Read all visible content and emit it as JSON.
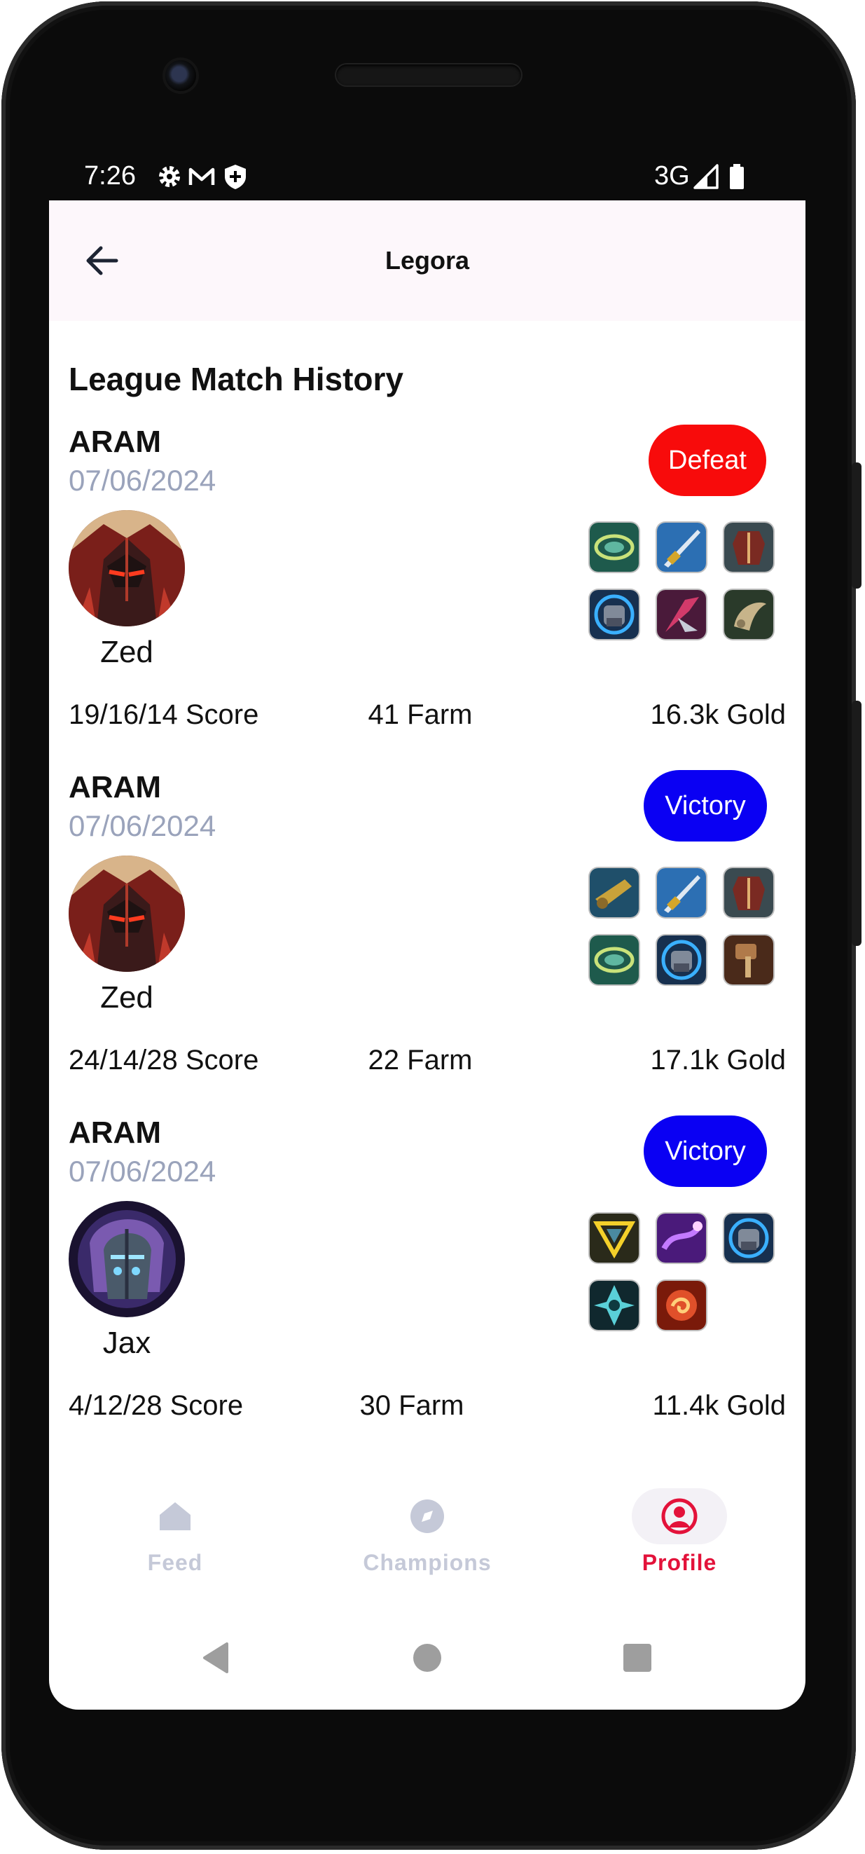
{
  "status_bar": {
    "time": "7:26",
    "network": "3G",
    "icons": [
      "settings-icon",
      "gmail-icon",
      "shield-icon",
      "signal-icon",
      "battery-icon"
    ]
  },
  "app_bar": {
    "title": "Legora",
    "back_icon": "arrow-left-icon"
  },
  "section_title": "League Match History",
  "matches": [
    {
      "mode": "ARAM",
      "date": "07/06/2024",
      "result": "Defeat",
      "result_color": "#f80b0b",
      "champion": "Zed",
      "score": "19/16/14 Score",
      "farm": "41 Farm",
      "gold": "16.3k Gold",
      "items": [
        "item-green-ring",
        "item-blue-blade",
        "item-red-armor",
        "item-blue-gauntlet",
        "item-purple-scythe",
        "item-beige-horn"
      ]
    },
    {
      "mode": "ARAM",
      "date": "07/06/2024",
      "result": "Victory",
      "result_color": "#0a00f3",
      "champion": "Zed",
      "score": "24/14/28 Score",
      "farm": "22 Farm",
      "gold": "17.1k Gold",
      "items": [
        "item-gold-cannon",
        "item-blue-blade",
        "item-red-armor",
        "item-green-ring",
        "item-blue-gauntlet",
        "item-bronze-hammer"
      ]
    },
    {
      "mode": "ARAM",
      "date": "07/06/2024",
      "result": "Victory",
      "result_color": "#0a00f3",
      "champion": "Jax",
      "score": "4/12/28 Score",
      "farm": "30 Farm",
      "gold": "11.4k Gold",
      "items": [
        "item-yellow-triforce",
        "item-violet-staff",
        "item-blue-gauntlet",
        "item-teal-shard",
        "item-red-orb"
      ]
    }
  ],
  "bottom_nav": [
    {
      "label": "Feed",
      "icon": "home-icon",
      "active": false
    },
    {
      "label": "Champions",
      "icon": "compass-icon",
      "active": false
    },
    {
      "label": "Profile",
      "icon": "profile-icon",
      "active": true
    }
  ],
  "colors": {
    "accent": "#e3123a",
    "defeat": "#f80b0b",
    "victory": "#0a00f3",
    "date_text": "#9aa3bb",
    "nav_inactive": "#c5c9d8",
    "app_bar_bg": "#fdf7fb"
  }
}
